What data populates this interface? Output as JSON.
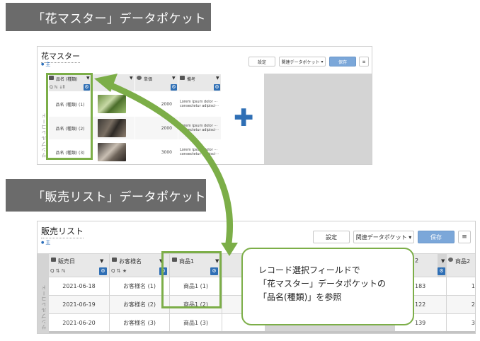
{
  "banners": {
    "top": "「花マスター」データポケット",
    "bottom": "「販売リスト」データポケット"
  },
  "flower_master": {
    "title": "花マスター",
    "subtitle": "主",
    "buttons": {
      "settings": "設定",
      "related": "関連データポケット",
      "save": "保存",
      "menu": "≡"
    },
    "columns": [
      "品名 (種類)",
      "",
      "単価",
      "備考"
    ],
    "filter": "Q ℕ ↓ll",
    "side_label": "サンプルレコード",
    "rows": [
      {
        "name": "品名 (種類) (1)",
        "price": "2000",
        "note1": "Lorem ipsum dolor ···",
        "note2": "consectetur adipisci···"
      },
      {
        "name": "品名 (種類) (2)",
        "price": "2000",
        "note1": "Lorem ipsum dolor ···",
        "note2": "consectetur adipisci···"
      },
      {
        "name": "品名 (種類) (3)",
        "price": "3000",
        "note1": "Lorem ipsum dolor ···",
        "note2": "consectetur adipisci···"
      }
    ]
  },
  "sales_list": {
    "title": "販売リスト",
    "subtitle": "主",
    "buttons": {
      "settings": "設定",
      "related": "関連データポケット",
      "save": "保存",
      "menu": "≡"
    },
    "columns": [
      "販売日",
      "お客様名",
      "商品1",
      "",
      "2",
      "商品2"
    ],
    "filters": {
      "date": "Q ⇅ ℕ",
      "customer": "Q ⇅ ★"
    },
    "side_label": "サンプルレコード",
    "rows": [
      {
        "date": "2021-06-18",
        "customer": "お客様名 (1)",
        "product": "商品1 (1)",
        "v": "183",
        "last": "1"
      },
      {
        "date": "2021-06-19",
        "customer": "お客様名 (2)",
        "product": "商品1 (2)",
        "v": "122",
        "last": "2"
      },
      {
        "date": "2021-06-20",
        "customer": "お客様名 (3)",
        "product": "商品1 (3)",
        "v": "139",
        "last": "3"
      }
    ]
  },
  "callout": {
    "line1": "レコード選択フィールドで",
    "line2": "「花マスター」データポケットの",
    "line3": "「品名(種類)」を参照"
  },
  "colors": {
    "highlight": "#7cae48",
    "accent": "#2f6fb5",
    "save": "#7ba7d9"
  }
}
